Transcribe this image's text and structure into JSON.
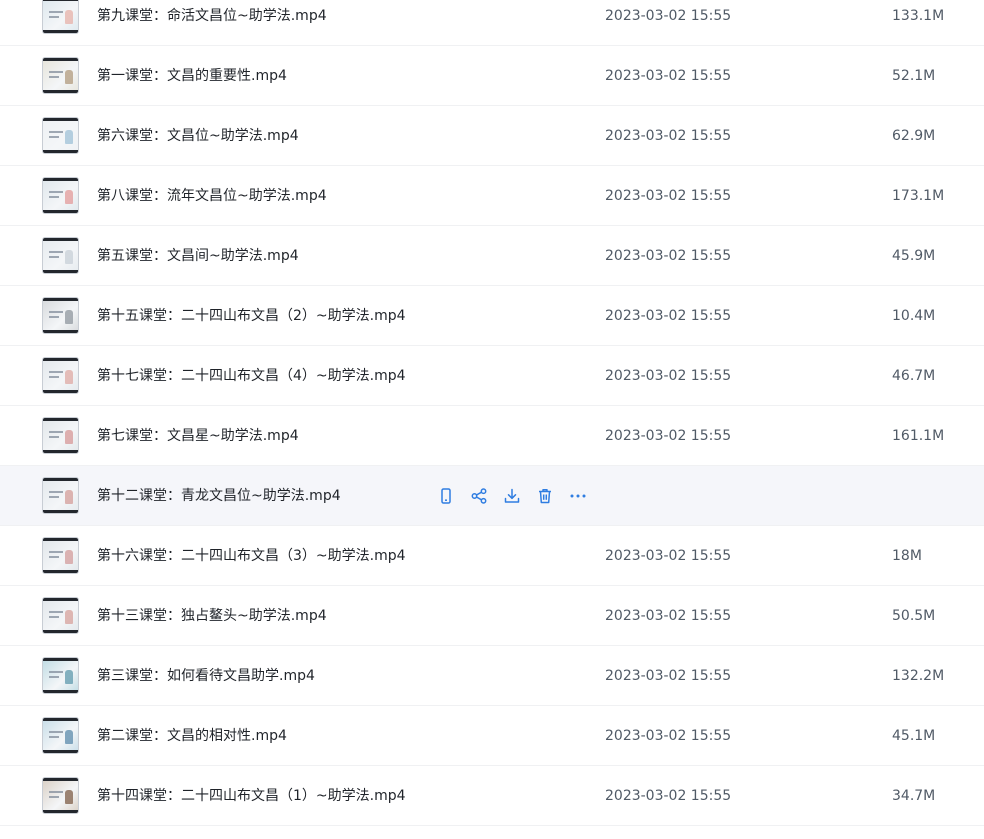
{
  "colors": {
    "accent": "#2f7de1",
    "row_hover_bg": "#f5f6fa",
    "divider": "#f0f1f3",
    "secondary_text": "#505a66"
  },
  "hover_actions": [
    {
      "name": "phone-view",
      "icon": "mobile-icon"
    },
    {
      "name": "share",
      "icon": "share-icon"
    },
    {
      "name": "download",
      "icon": "download-icon"
    },
    {
      "name": "delete",
      "icon": "trash-icon"
    },
    {
      "name": "more",
      "icon": "more-horizontal-icon"
    }
  ],
  "files": [
    {
      "name": "第九课堂：命活文昌位~助学法.mp4",
      "date": "2023-03-02 15:55",
      "size": "133.1M",
      "thumb": "#dde8ee",
      "figure": "#e7b9b2"
    },
    {
      "name": "第一课堂：文昌的重要性.mp4",
      "date": "2023-03-02 15:55",
      "size": "52.1M",
      "thumb": "#e6e4da",
      "figure": "#b9a48b"
    },
    {
      "name": "第六课堂：文昌位~助学法.mp4",
      "date": "2023-03-02 15:55",
      "size": "62.9M",
      "thumb": "#eef1f4",
      "figure": "#a8c7da"
    },
    {
      "name": "第八课堂：流年文昌位~助学法.mp4",
      "date": "2023-03-02 15:55",
      "size": "173.1M",
      "thumb": "#dfe7ec",
      "figure": "#e4a5a5"
    },
    {
      "name": "第五课堂：文昌间~助学法.mp4",
      "date": "2023-03-02 15:55",
      "size": "45.9M",
      "thumb": "#e6ebef",
      "figure": "#cdd3da"
    },
    {
      "name": "第十五课堂：二十四山布文昌（2）~助学法.mp4",
      "date": "2023-03-02 15:55",
      "size": "10.4M",
      "thumb": "#d6d9dc",
      "figure": "#9aa1a8"
    },
    {
      "name": "第十七课堂：二十四山布文昌（4）~助学法.mp4",
      "date": "2023-03-02 15:55",
      "size": "46.7M",
      "thumb": "#e3e8ec",
      "figure": "#e0b2ad"
    },
    {
      "name": "第七课堂：文昌星~助学法.mp4",
      "date": "2023-03-02 15:55",
      "size": "161.1M",
      "thumb": "#e2e7ea",
      "figure": "#d9a2a2"
    },
    {
      "name": "第十二课堂：青龙文昌位~助学法.mp4",
      "date": "",
      "size": "",
      "thumb": "#e4e9ed",
      "figure": "#d7a7a3",
      "hovered": true
    },
    {
      "name": "第十六课堂：二十四山布文昌（3）~助学法.mp4",
      "date": "2023-03-02 15:55",
      "size": "18M",
      "thumb": "#e1e6ea",
      "figure": "#d6a6a6"
    },
    {
      "name": "第十三课堂：独占鳌头~助学法.mp4",
      "date": "2023-03-02 15:55",
      "size": "50.5M",
      "thumb": "#e2e7eb",
      "figure": "#d9aaa6"
    },
    {
      "name": "第三课堂：如何看待文昌助学.mp4",
      "date": "2023-03-02 15:55",
      "size": "132.2M",
      "thumb": "#bfdbe3",
      "figure": "#6fa3b5"
    },
    {
      "name": "第二课堂：文昌的相对性.mp4",
      "date": "2023-03-02 15:55",
      "size": "45.1M",
      "thumb": "#c7dde8",
      "figure": "#6c97b4"
    },
    {
      "name": "第十四课堂：二十四山布文昌（1）~助学法.mp4",
      "date": "2023-03-02 15:55",
      "size": "34.7M",
      "thumb": "#d9cfc4",
      "figure": "#8c6f5a"
    }
  ]
}
